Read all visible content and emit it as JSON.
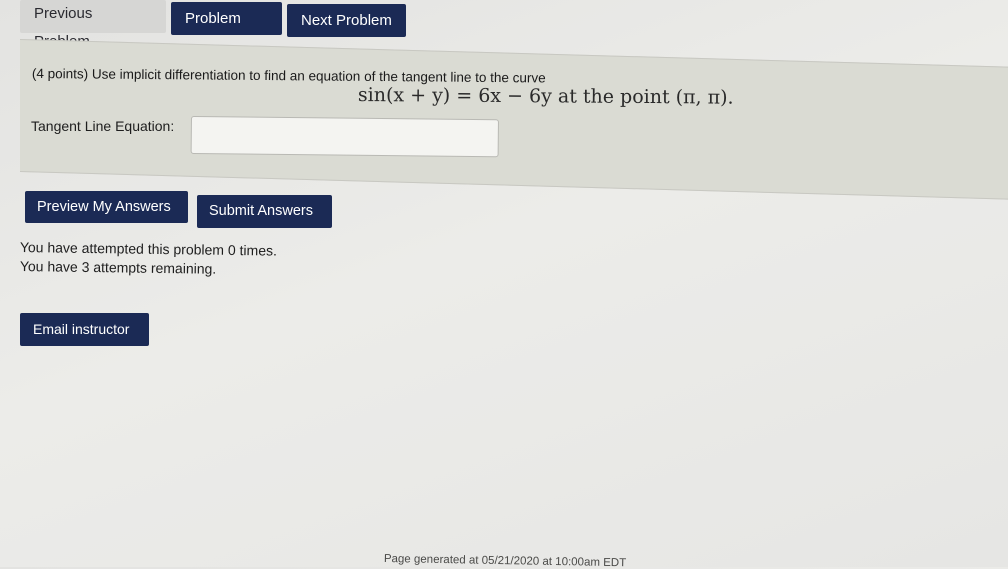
{
  "nav": {
    "previous": "Previous Problem",
    "list": "Problem List",
    "next": "Next Problem"
  },
  "problem": {
    "prompt": "(4 points) Use implicit differentiation to find an equation of the tangent line to the curve",
    "equation_text": "sin(x + y) = 6x − 6y at the point (π, π).",
    "answer_label": "Tangent Line Equation:",
    "answer_value": ""
  },
  "actions": {
    "preview": "Preview My Answers",
    "submit": "Submit Answers"
  },
  "status": {
    "attempted": "You have attempted this problem 0 times.",
    "remaining": "You have 3 attempts remaining."
  },
  "email": "Email instructor",
  "footer": "Page generated at 05/21/2020 at 10:00am EDT",
  "colors": {
    "button_bg": "#1b2a55",
    "panel_bg": "#dadbd3"
  }
}
